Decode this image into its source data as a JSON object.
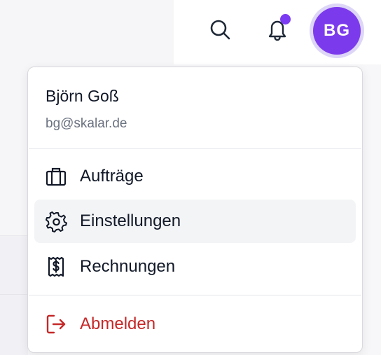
{
  "header": {
    "avatar_initials": "BG",
    "search_icon": "search-icon",
    "notification_icon": "bell-icon",
    "notification_indicator": true,
    "accent_color": "#7c3aed"
  },
  "menu": {
    "user": {
      "name": "Björn Goß",
      "email": "bg@skalar.de"
    },
    "items": [
      {
        "label": "Aufträge",
        "icon": "briefcase-icon"
      },
      {
        "label": "Einstellungen",
        "icon": "gear-icon"
      },
      {
        "label": "Rechnungen",
        "icon": "receipt-icon"
      }
    ],
    "logout": {
      "label": "Abmelden",
      "icon": "logout-icon",
      "color": "#c62828"
    }
  }
}
